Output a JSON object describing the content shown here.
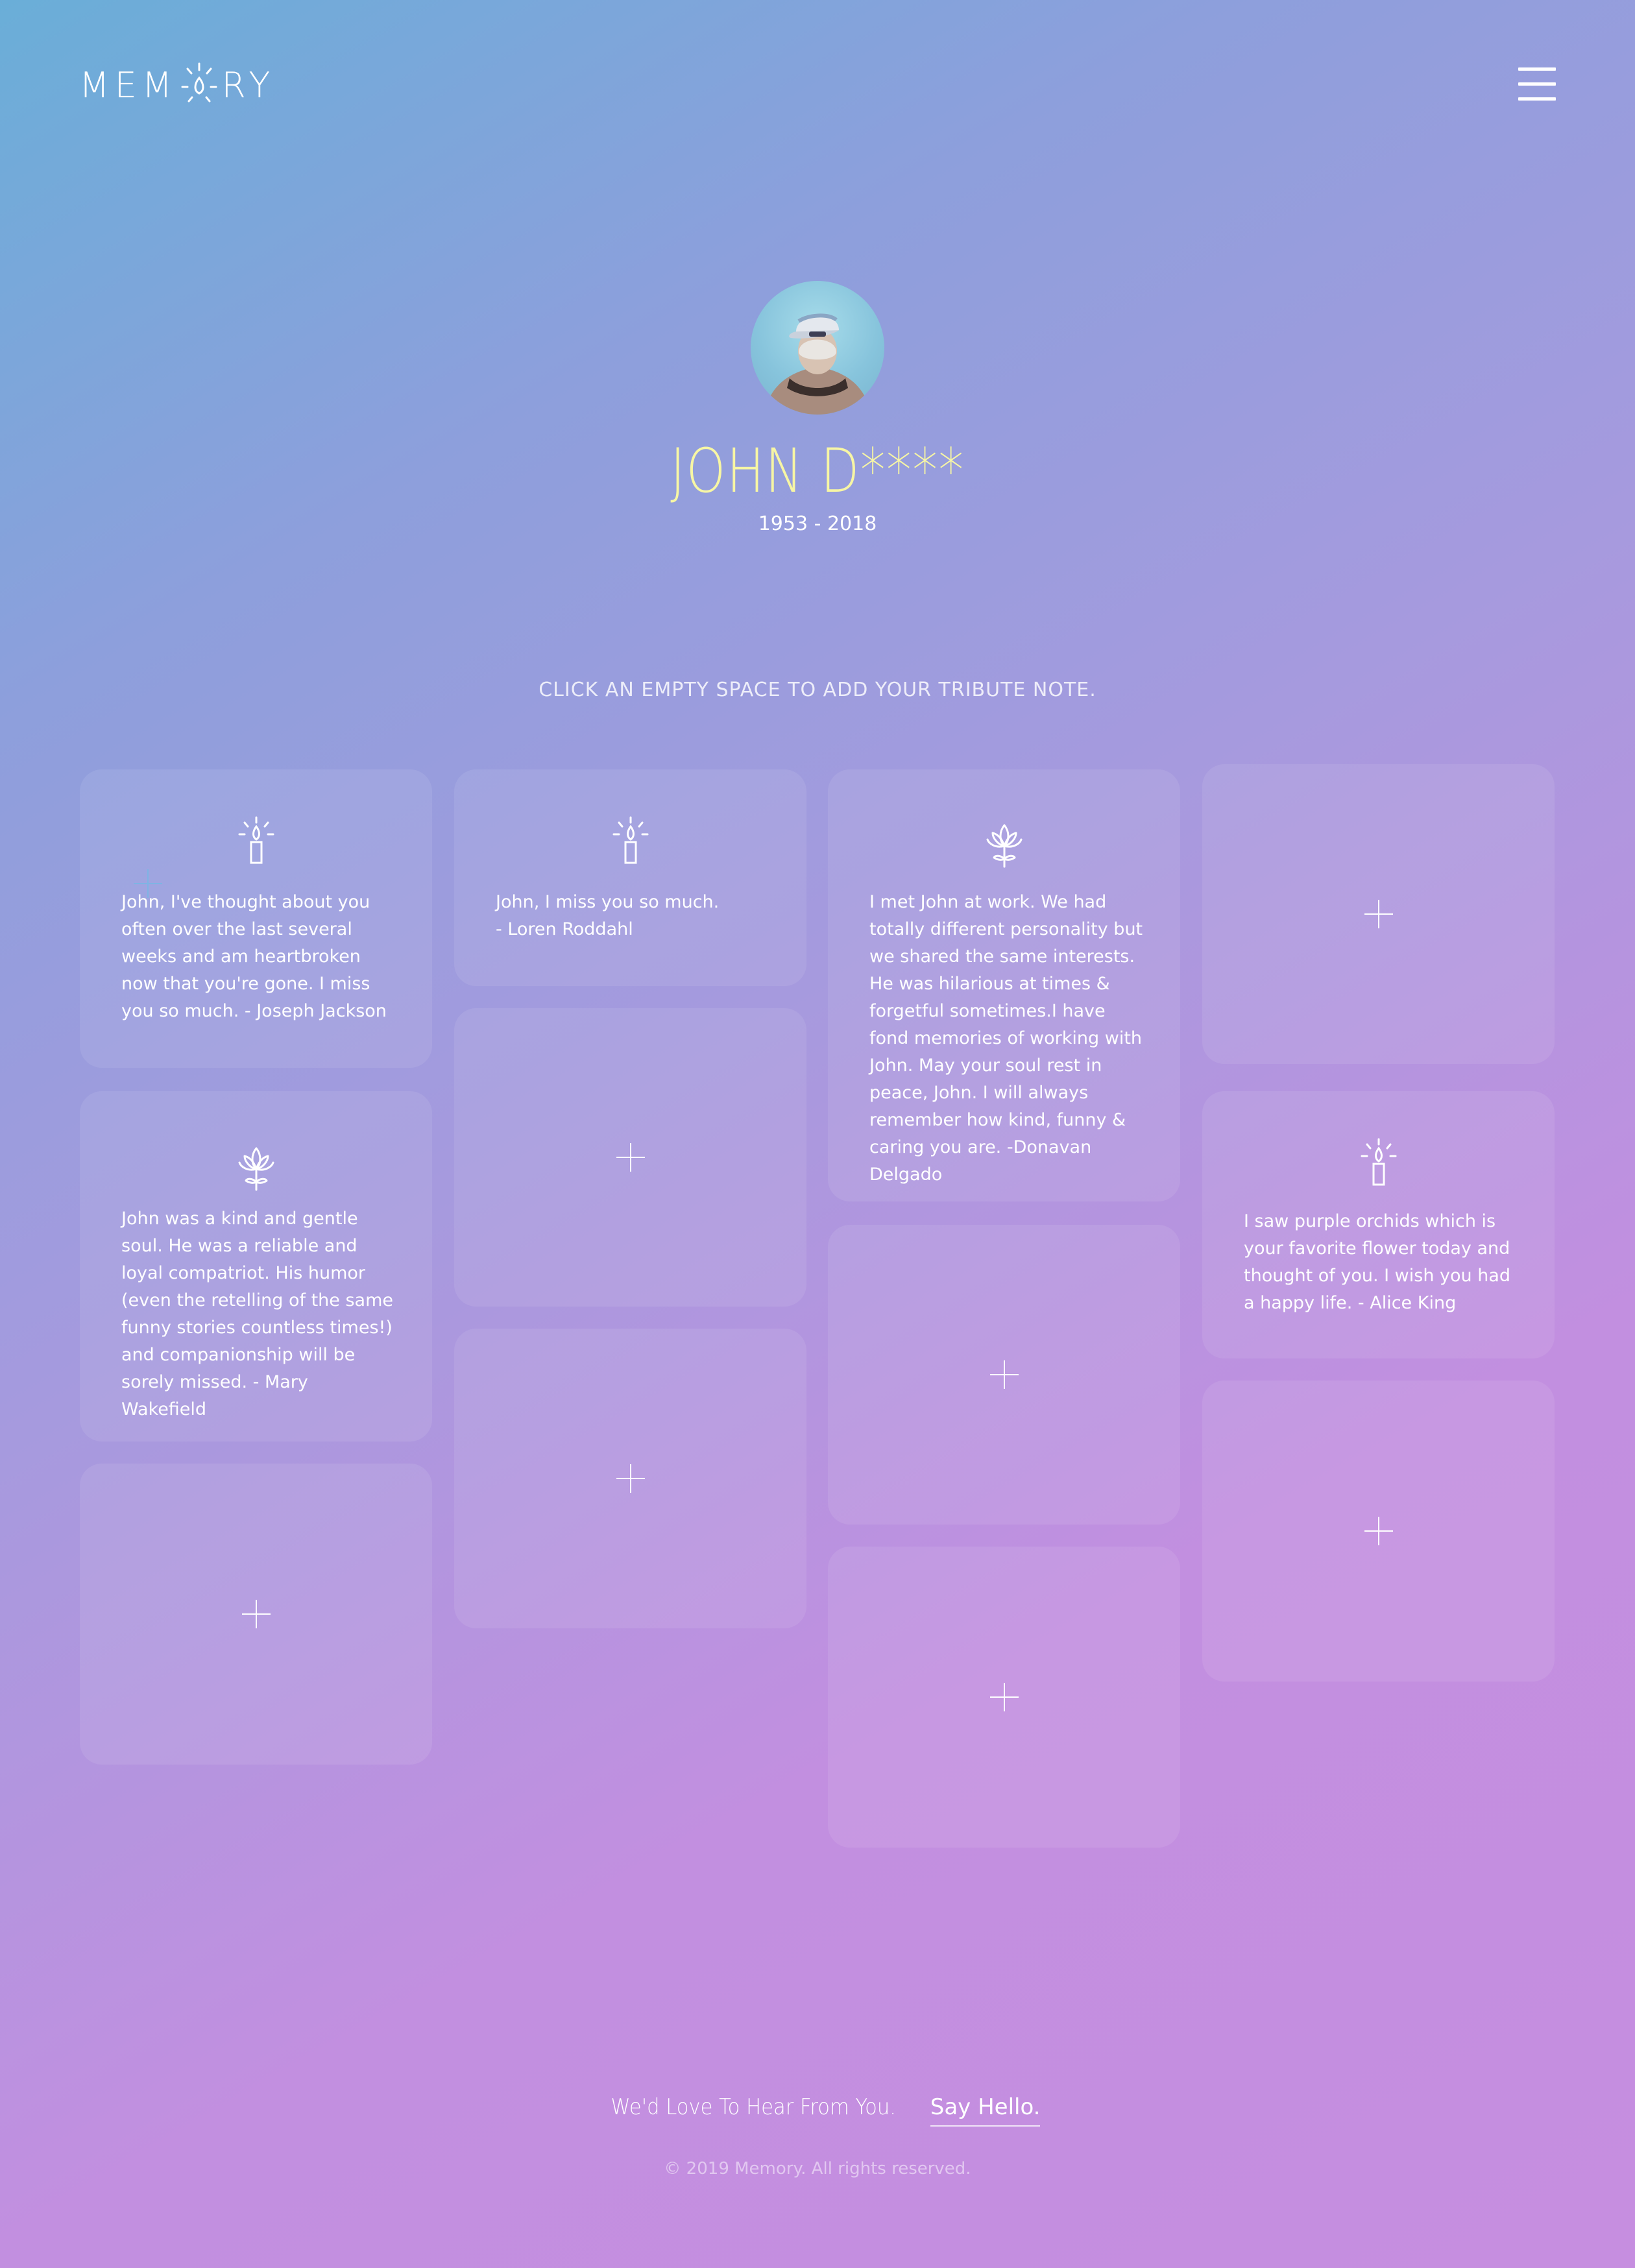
{
  "header": {
    "logo_left": "MEM",
    "logo_right": "RY",
    "logo_icon": "candle-flame-o-icon",
    "menu_icon": "hamburger-menu-icon"
  },
  "profile": {
    "name": "JOHN D****",
    "dates": "1953 - 2018",
    "avatar_icon": "person-cap-avatar"
  },
  "instruction": "CLICK AN EMPTY SPACE TO ADD YOUR TRIBUTE NOTE.",
  "tributes": [
    {
      "icon": "candle-icon",
      "text": "John, I've thought about you often over the last several weeks and am heartbroken now that you're gone. I miss you so much. - Joseph Jackson"
    },
    {
      "icon": "candle-icon",
      "text": "John, I miss you so much.\n- Loren Roddahl"
    },
    {
      "icon": "lotus-icon",
      "text": "I met John at work. We had totally different personality but we shared the same interests. He was hilarious at times & forgetful sometimes.I have fond memories of working with John. May your soul rest in peace, John. I will always remember how kind, funny & caring you are. -Donavan Delgado"
    },
    {
      "icon": "lotus-icon",
      "text": "John was a kind and gentle soul. He was a reliable and loyal compatriot. His humor (even the retelling of the same funny stories countless times!) and companionship will be sorely missed.  - Mary Wakefield"
    },
    {
      "icon": "candle-icon",
      "text": "I saw purple orchids which is your favorite flower today and thought of you. I wish you had a happy life. - Alice King"
    }
  ],
  "empty_slot_icon": "plus-icon",
  "footer": {
    "lead": "We'd Love To Hear From You.",
    "link": "Say Hello.",
    "copyright": "© 2019 Memory. All rights reserved."
  },
  "colors": {
    "name": "#f7f6a4",
    "gradient_start": "#6aaed8",
    "gradient_end": "#c68ee0"
  }
}
